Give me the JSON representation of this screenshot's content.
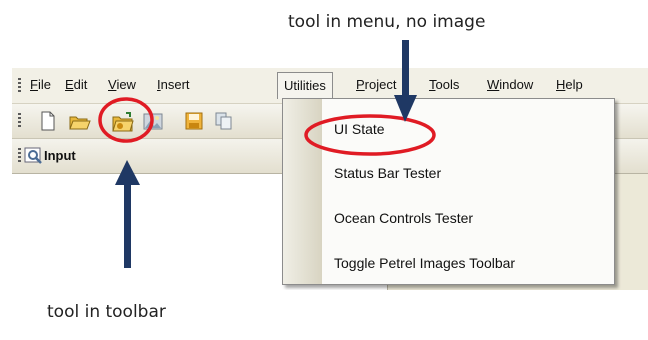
{
  "captions": {
    "top": "tool in menu, no image",
    "bottom": "tool in toolbar"
  },
  "menubar": {
    "items": [
      {
        "label": "File",
        "mnemonic": "F",
        "rest": "ile"
      },
      {
        "label": "Edit",
        "mnemonic": "E",
        "rest": "dit"
      },
      {
        "label": "View",
        "mnemonic": "V",
        "rest": "iew"
      },
      {
        "label": "Insert",
        "mnemonic": "I",
        "rest": "nsert"
      },
      {
        "label": "Utilities"
      },
      {
        "label": "Project",
        "mnemonic": "P",
        "rest": "roject"
      },
      {
        "label": "Tools",
        "mnemonic": "T",
        "rest": "ools"
      },
      {
        "label": "Window",
        "mnemonic": "W",
        "rest": "indow"
      },
      {
        "label": "Help",
        "mnemonic": "H",
        "rest": "elp"
      }
    ]
  },
  "toolbar": {
    "buttons": [
      "new-document-icon",
      "open-folder-icon",
      "open-plugin-folder-icon",
      "image-icon",
      "save-icon",
      "copy-icon"
    ]
  },
  "input_panel": {
    "label": "Input",
    "icon": "magnifier-icon"
  },
  "dropdown": {
    "items": [
      {
        "label": "UI State"
      },
      {
        "label": "Status Bar Tester"
      },
      {
        "label": "Ocean Controls Tester"
      },
      {
        "label": "Toggle Petrel Images Toolbar"
      }
    ]
  },
  "colors": {
    "annotation_circle": "#e01b24",
    "annotation_arrow": "#1f3864",
    "menu_bar": "#f2f0e6",
    "window_face": "#ece9d8"
  }
}
